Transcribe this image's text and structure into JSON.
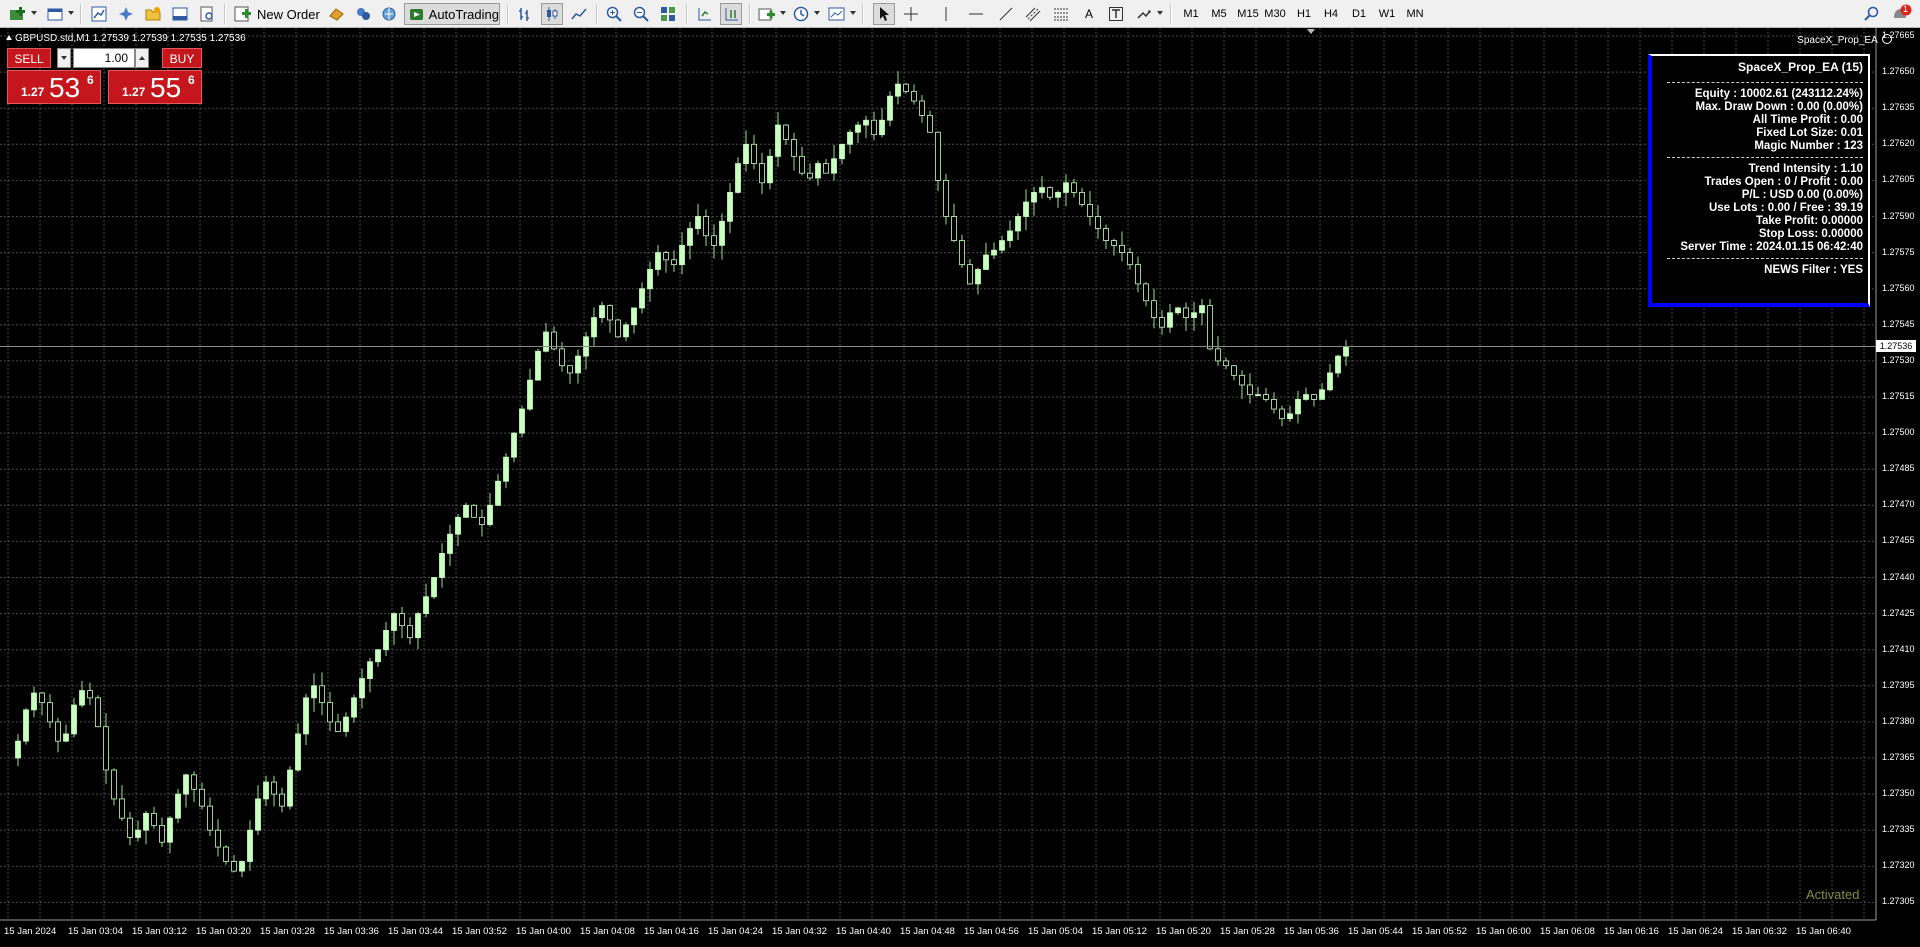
{
  "toolbar": {
    "new_order_label": "New Order",
    "autotrading_label": "AutoTrading",
    "timeframes": [
      "M1",
      "M5",
      "M15",
      "M30",
      "H1",
      "H4",
      "D1",
      "W1",
      "MN"
    ],
    "notification_count": "1"
  },
  "chart": {
    "symbol_line": "GBPUSD.std,M1  1.27539 1.27539 1.27535 1.27536",
    "ea_name": "SpaceX_Prop_EA",
    "current_price": "1.27536",
    "activated_text": "Activated",
    "price_labels": [
      "1.27665",
      "1.27650",
      "1.27635",
      "1.27620",
      "1.27605",
      "1.27590",
      "1.27575",
      "1.27560",
      "1.27545",
      "1.27530",
      "1.27515",
      "1.27500",
      "1.27485",
      "1.27470",
      "1.27455",
      "1.27440",
      "1.27425",
      "1.27410",
      "1.27395",
      "1.27380",
      "1.27365",
      "1.27350",
      "1.27335",
      "1.27320",
      "1.27305"
    ],
    "time_labels": [
      "15 Jan 2024",
      "15 Jan 03:04",
      "15 Jan 03:12",
      "15 Jan 03:20",
      "15 Jan 03:28",
      "15 Jan 03:36",
      "15 Jan 03:44",
      "15 Jan 03:52",
      "15 Jan 04:00",
      "15 Jan 04:08",
      "15 Jan 04:16",
      "15 Jan 04:24",
      "15 Jan 04:32",
      "15 Jan 04:40",
      "15 Jan 04:48",
      "15 Jan 04:56",
      "15 Jan 05:04",
      "15 Jan 05:12",
      "15 Jan 05:20",
      "15 Jan 05:28",
      "15 Jan 05:36",
      "15 Jan 05:44",
      "15 Jan 05:52",
      "15 Jan 06:00",
      "15 Jan 06:08",
      "15 Jan 06:16",
      "15 Jan 06:24",
      "15 Jan 06:32",
      "15 Jan 06:40"
    ],
    "colors": {
      "background": "#000000",
      "grid": "#4a4a4a",
      "bull": "#c8ffc0",
      "bear": "#000000",
      "wick": "#9be090"
    },
    "price_range": [
      1.27305,
      1.27665
    ],
    "close_path": [
      1.27365,
      1.27372,
      1.27385,
      1.27392,
      1.27388,
      1.2738,
      1.27372,
      1.27375,
      1.27387,
      1.27393,
      1.2739,
      1.27378,
      1.2736,
      1.27348,
      1.2734,
      1.27332,
      1.27335,
      1.27342,
      1.27337,
      1.2733,
      1.2734,
      1.2735,
      1.27358,
      1.27352,
      1.27345,
      1.27335,
      1.27328,
      1.27322,
      1.27318,
      1.27322,
      1.27335,
      1.27348,
      1.27355,
      1.2735,
      1.27345,
      1.2736,
      1.27375,
      1.2739,
      1.27395,
      1.27388,
      1.2738,
      1.27376,
      1.27382,
      1.2739,
      1.27398,
      1.27405,
      1.2741,
      1.27418,
      1.27425,
      1.2742,
      1.27415,
      1.27425,
      1.27432,
      1.2744,
      1.2745,
      1.27458,
      1.27465,
      1.2747,
      1.27465,
      1.27462,
      1.2747,
      1.2748,
      1.2749,
      1.275,
      1.2751,
      1.27522,
      1.27534,
      1.27542,
      1.27535,
      1.27528,
      1.27525,
      1.27532,
      1.2754,
      1.27548,
      1.27553,
      1.27547,
      1.2754,
      1.27545,
      1.27552,
      1.2756,
      1.27568,
      1.27575,
      1.27572,
      1.2757,
      1.27578,
      1.27585,
      1.2759,
      1.27582,
      1.27578,
      1.27588,
      1.276,
      1.27612,
      1.2762,
      1.27612,
      1.27604,
      1.27615,
      1.27628,
      1.27622,
      1.27615,
      1.27608,
      1.27606,
      1.27612,
      1.27608,
      1.27614,
      1.2762,
      1.27625,
      1.27628,
      1.2763,
      1.27624,
      1.2763,
      1.2764,
      1.27645,
      1.27642,
      1.27638,
      1.27632,
      1.27625,
      1.27605,
      1.2759,
      1.2758,
      1.2757,
      1.27562,
      1.27568,
      1.27574,
      1.27576,
      1.2758,
      1.27584,
      1.2759,
      1.27596,
      1.276,
      1.27602,
      1.27598,
      1.276,
      1.27604,
      1.276,
      1.27595,
      1.2759,
      1.27585,
      1.2758,
      1.27578,
      1.27575,
      1.2757,
      1.27562,
      1.27555,
      1.27548,
      1.27544,
      1.2755,
      1.27552,
      1.27548,
      1.2755,
      1.27553,
      1.27535,
      1.2753,
      1.27528,
      1.27524,
      1.2752,
      1.27516,
      1.27516,
      1.27514,
      1.2751,
      1.27506,
      1.27508,
      1.27514,
      1.27516,
      1.27514,
      1.27518,
      1.27525,
      1.27532,
      1.27536
    ]
  },
  "one_click": {
    "sell_label": "SELL",
    "buy_label": "BUY",
    "lot_value": "1.00",
    "sell_small": "1.27",
    "sell_big": "53",
    "sell_sup": "6",
    "buy_small": "1.27",
    "buy_big": "55",
    "buy_sup": "6"
  },
  "panel": {
    "title": "SpaceX_Prop_EA (15)",
    "group1": [
      "Equity : 10002.61 (243112.24%)",
      "Max. Draw Down : 0.00 (0.00%)",
      "All Time Profit : 0.00",
      "Fixed Lot Size: 0.01",
      "Magic Number : 123"
    ],
    "group2": [
      "Trend Intensity : 1.10",
      "Trades Open : 0 / Profit : 0.00",
      "P/L : USD 0.00 (0.00%)",
      "Use Lots : 0.00 / Free : 39.19",
      "Take Profit: 0.00000",
      "Stop Loss: 0.00000",
      "Server Time : 2024.01.15 06:42:40"
    ],
    "news": "NEWS Filter : YES"
  }
}
